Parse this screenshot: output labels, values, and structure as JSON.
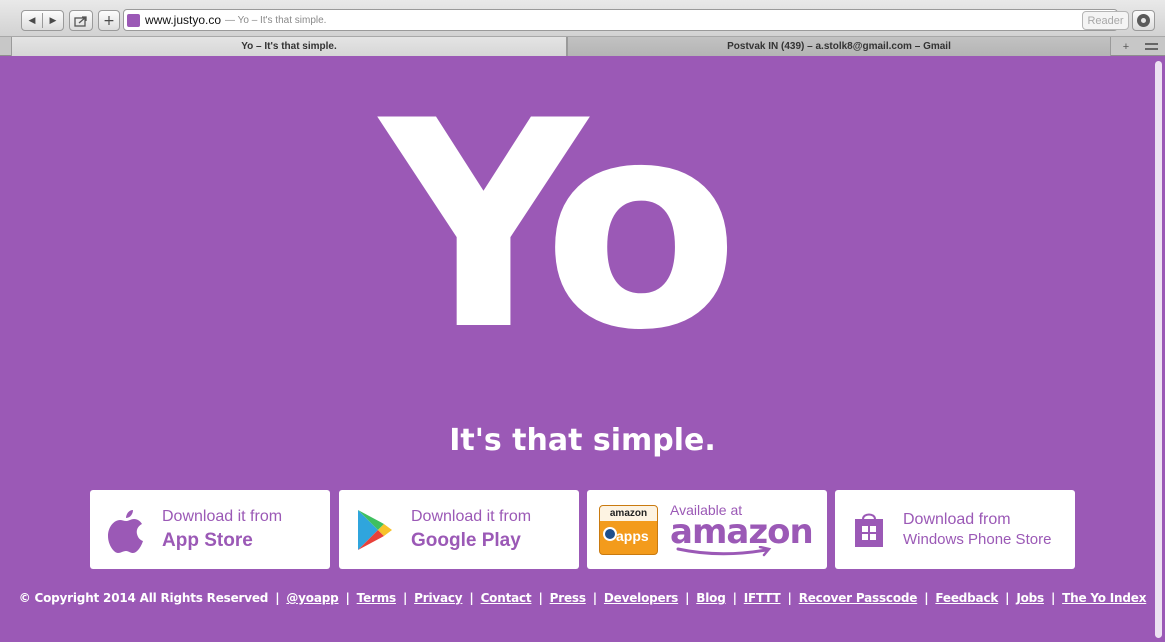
{
  "browser": {
    "url_host": "www.justyo.co",
    "url_title": "— Yo – It's that simple.",
    "reader_label": "Reader",
    "reload_icon": "reload-icon",
    "tabs": [
      {
        "label": "Yo – It's that simple.",
        "active": true
      },
      {
        "label": "Postvak IN (439) – a.stolk8@gmail.com – Gmail",
        "active": false
      }
    ],
    "new_tab_label": "+"
  },
  "page": {
    "background": "#9b59b6",
    "logo_text": "Yo",
    "tagline": "It's that simple.",
    "badges": [
      {
        "line1": "Download it from",
        "line2": "App Store",
        "icon": "apple-icon"
      },
      {
        "line1": "Download it from",
        "line2": "Google Play",
        "icon": "google-play-icon"
      },
      {
        "line1": "Available at",
        "line2": "amazon",
        "icon": "amazon-apps-icon",
        "icon_text_top": "amazon",
        "icon_text_bottom": "apps"
      },
      {
        "line1": "Download from",
        "line2": "Windows Phone Store",
        "icon": "windows-store-icon"
      }
    ],
    "footer": {
      "copyright": "© Copyright 2014 All Rights Reserved",
      "links": [
        "@yoapp",
        "Terms",
        "Privacy",
        "Contact",
        "Press",
        "Developers",
        "Blog",
        "IFTTT",
        "Recover Passcode",
        "Feedback",
        "Jobs",
        "The Yo Index"
      ]
    }
  }
}
